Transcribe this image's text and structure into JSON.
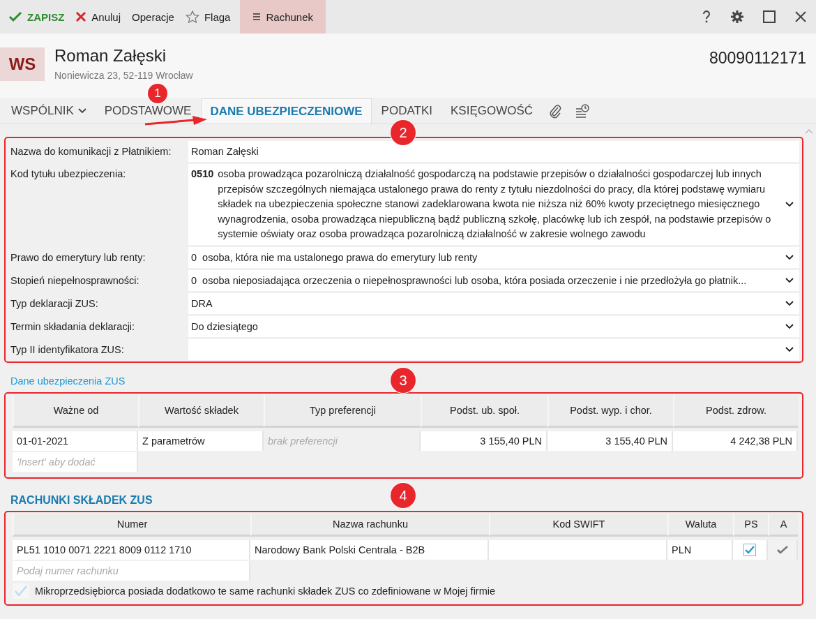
{
  "toolbar": {
    "items": [
      {
        "kind": "save",
        "label": "ZAPISZ",
        "selected": false
      },
      {
        "kind": "cancel",
        "label": "Anuluj",
        "selected": false
      },
      {
        "kind": "plain",
        "label": "Operacje",
        "selected": false
      },
      {
        "kind": "flag",
        "label": "Flaga",
        "selected": false
      },
      {
        "kind": "menu",
        "label": "Rachunek",
        "selected": true
      }
    ]
  },
  "header": {
    "initials": "WS",
    "name": "Roman Załęski",
    "address": "Noniewicza 23, 52-119 Wrocław",
    "number": "80090112171"
  },
  "tabs": [
    {
      "kind": "dropdown",
      "label": "WSPÓLNIK",
      "selected": false
    },
    {
      "kind": "text",
      "label": "PODSTAWOWE",
      "selected": false
    },
    {
      "kind": "text",
      "label": "DANE UBEZPIECZENIOWE",
      "selected": true
    },
    {
      "kind": "text",
      "label": "PODATKI",
      "selected": false
    },
    {
      "kind": "text",
      "label": "KSIĘGOWOŚĆ",
      "selected": false
    },
    {
      "kind": "attachment",
      "selected": false
    },
    {
      "kind": "history",
      "selected": false
    }
  ],
  "form": [
    {
      "label": "Nazwa do komunikacji z Płatnikiem:",
      "kind": "text",
      "value": "Roman Załęski"
    },
    {
      "label": "Kod tytułu ubezpieczenia:",
      "kind": "select",
      "code": "0510",
      "value": "osoba prowadząca pozarolniczą działalność gospodarczą na podstawie przepisów o działalności gospodarczej lub innych przepisów szczególnych niemająca ustalonego prawa do renty z tytułu niezdolności do pracy, dla której podstawę wymiaru składek na ubezpieczenia społeczne stanowi zadeklarowana kwota nie niższa niż 60% kwoty przeciętnego miesięcznego wynagrodzenia, osoba prowadząca niepubliczną bądź publiczną szkołę, placówkę lub ich zespół, na podstawie przepisów o systemie oświaty oraz osoba prowadząca pozarolniczą działalność w zakresie wolnego zawodu"
    },
    {
      "label": "Prawo do emerytury lub renty:",
      "kind": "select",
      "value": "0  osoba, która nie ma ustalonego prawa do emerytury lub renty"
    },
    {
      "label": "Stopień niepełnosprawności:",
      "kind": "select",
      "value": "0  osoba nieposiadająca orzeczenia o niepełnosprawności lub osoba, która posiada orzeczenie i nie przedłożyła go płatnik..."
    },
    {
      "label": "Typ deklaracji ZUS:",
      "kind": "select",
      "value": "DRA"
    },
    {
      "label": "Termin składania deklaracji:",
      "kind": "select",
      "value": "Do dziesiątego"
    },
    {
      "label": "Typ II identyfikatora ZUS:",
      "kind": "select"
    }
  ],
  "insurance": {
    "title": "Dane ubezpieczenia ZUS",
    "columns": [
      "Ważne od",
      "Wartość składek",
      "Typ preferencji",
      "Podst. ub. społ.",
      "Podst. wyp. i chor.",
      "Podst. zdrow."
    ],
    "rows": [
      [
        "01-01-2021",
        "Z parametrów",
        "brak preferencji",
        "3 155,40 PLN",
        "3 155,40 PLN",
        "4 242,38 PLN"
      ]
    ],
    "add_placeholder": "'Insert' aby dodać"
  },
  "accounts": {
    "title": "RACHUNKI SKŁADEK ZUS",
    "columns": [
      "Numer",
      "Nazwa rachunku",
      "Kod SWIFT",
      "Waluta",
      "PS",
      "A"
    ],
    "rows": [
      {
        "number": "PL51 1010 0071 2221 8009 0112 1710",
        "name": "Narodowy Bank Polski Centrala - B2B",
        "swift": "",
        "currency": "PLN",
        "ps": true,
        "a": true
      }
    ],
    "add_placeholder": "Podaj numer rachunku",
    "same_accounts": {
      "label": "Mikroprzedsiębiorca posiada dodatkowo te same rachunki składek ZUS co zdefiniowane w Mojej firmie",
      "checked": true,
      "disabled": true
    }
  },
  "annotations": [
    "1",
    "2",
    "3",
    "4"
  ]
}
